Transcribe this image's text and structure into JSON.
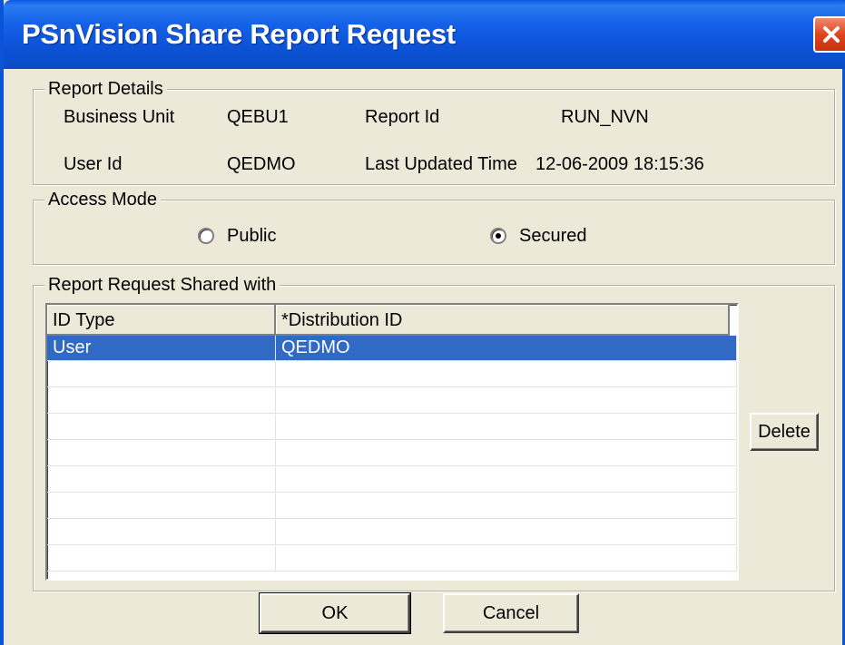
{
  "window": {
    "title": "PSnVision Share Report Request"
  },
  "report_details": {
    "legend": "Report Details",
    "business_unit_label": "Business Unit",
    "business_unit_value": "QEBU1",
    "report_id_label": "Report Id",
    "report_id_value": "RUN_NVN",
    "user_id_label": "User Id",
    "user_id_value": "QEDMO",
    "last_updated_label": "Last Updated Time",
    "last_updated_value": "12-06-2009 18:15:36"
  },
  "access_mode": {
    "legend": "Access Mode",
    "options": [
      {
        "label": "Public",
        "selected": false
      },
      {
        "label": "Secured",
        "selected": true
      }
    ]
  },
  "shared_with": {
    "legend": "Report Request Shared with",
    "columns": [
      "ID Type",
      "*Distribution ID"
    ],
    "rows": [
      [
        "User",
        "QEDMO"
      ],
      [
        "",
        ""
      ],
      [
        "",
        ""
      ],
      [
        "",
        ""
      ],
      [
        "",
        ""
      ],
      [
        "",
        ""
      ],
      [
        "",
        ""
      ],
      [
        "",
        ""
      ],
      [
        "",
        ""
      ]
    ],
    "selected_row": 0,
    "delete_label": "Delete"
  },
  "buttons": {
    "ok_label": "OK",
    "cancel_label": "Cancel"
  },
  "colors": {
    "title_bar": "#0b54d8",
    "selection": "#316ac5",
    "close_button": "#e0441e"
  }
}
